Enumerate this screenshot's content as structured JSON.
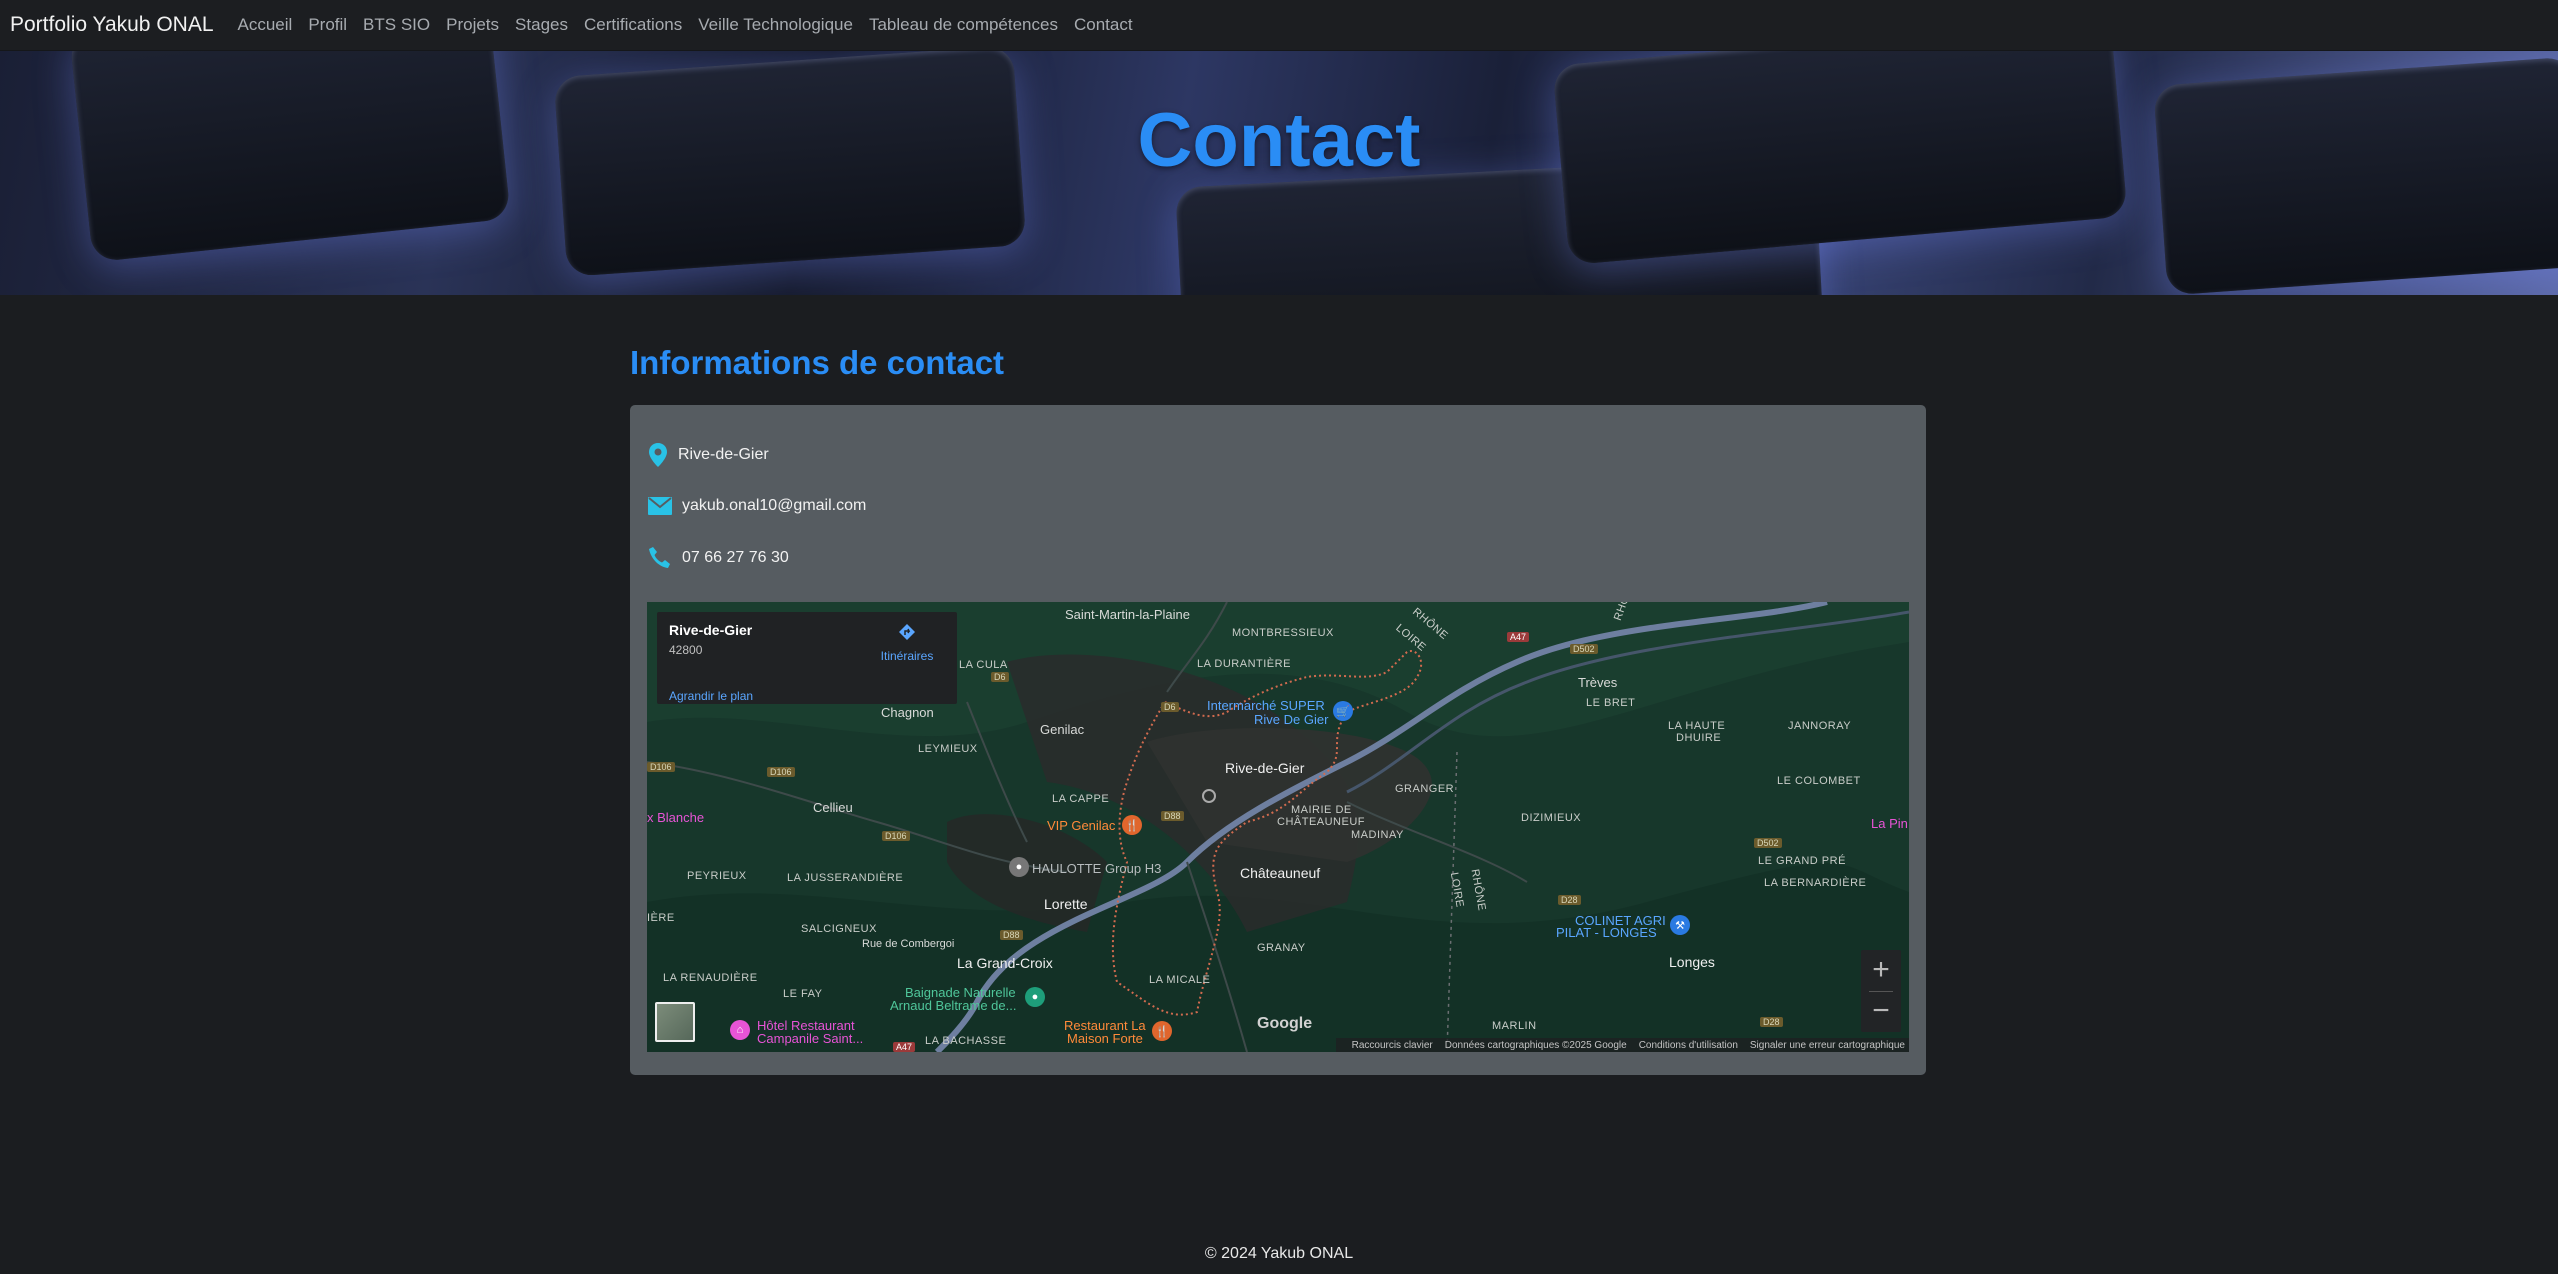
{
  "navbar": {
    "brand": "Portfolio Yakub ONAL",
    "links": [
      "Accueil",
      "Profil",
      "BTS SIO",
      "Projets",
      "Stages",
      "Certifications",
      "Veille Technologique",
      "Tableau de compétences",
      "Contact"
    ]
  },
  "hero": {
    "title": "Contact"
  },
  "contact": {
    "heading": "Informations de contact",
    "location": "Rive-de-Gier",
    "email": "yakub.onal10@gmail.com",
    "phone": "07 66 27 76 30"
  },
  "map": {
    "info": {
      "title": "Rive-de-Gier",
      "postcode": "42800",
      "directions": "Itinéraires",
      "enlarge": "Agrandir le plan"
    },
    "labels": {
      "saint_martin": "Saint-Martin-la-Plaine",
      "montbressieux": "MONTBRESSIEUX",
      "durantiere": "LA DURANTIÈRE",
      "la_cula": "LA CULA",
      "chagnon": "Chagnon",
      "genilac": "Genilac",
      "leymieux": "LEYMIEUX",
      "intermarche_1": "Intermarché SUPER",
      "intermarche_2": "Rive De Gier",
      "rive": "Rive-de-Gier",
      "treves": "Trèves",
      "le_bret": "LE BRET",
      "haute_dhuire_1": "LA HAUTE",
      "haute_dhuire_2": "DHUIRE",
      "janniorai": "JANNORAY",
      "colombet": "LE COLOMBET",
      "cellieu": "Cellieu",
      "la_cappe": "LA CAPPE",
      "croix_blanche": "x Blanche",
      "vip_genilac": "VIP Genilac",
      "granger": "GRANGER",
      "mairie_1": "MAIRIE DE",
      "mairie_2": "CHÂTEAUNEUF",
      "madinay": "MADINAY",
      "dizimieux": "DIZIMIEUX",
      "la_pin": "La Pin",
      "peyrieux": "PEYRIEUX",
      "jusseranderie": "LA JUSSERANDIÈRE",
      "haulotte": "HAULOTTE Group H3",
      "chateauneuf": "Châteauneuf",
      "grand_pre": "LE GRAND PRÉ",
      "bernardiere": "LA BERNARDIÈRE",
      "lorette": "Lorette",
      "saint_riere": "IÈRE",
      "salcigneux": "SALCIGNEUX",
      "rue_combe": "Rue de Combergoi",
      "granay": "GRANAY",
      "colinet_1": "COLINET AGRI",
      "colinet_2": "PILAT - LONGES",
      "grand_croix": "La Grand-Croix",
      "longes": "Longes",
      "renaudiere": "LA RENAUDIÈRE",
      "le_fay": "LE FAY",
      "baignade_1": "Baignade Naturelle",
      "baignade_2": "Arnaud Beltrame de...",
      "la_micale": "LA MICALE",
      "marlin": "MARLIN",
      "hotel_1": "Hôtel Restaurant",
      "hotel_2": "Campanile Saint...",
      "bachasse": "LA BACHASSE",
      "maison_1": "Restaurant La",
      "maison_2": "Maison Forte",
      "rhone_loire_1": "RHÔNE",
      "rhone_loire_2": "LOIRE",
      "rhone_loire_3": "RHÔNE",
      "rhone_loire_4": "LOIRE",
      "rhone_top": "RHÔ"
    },
    "road_tags": {
      "a47_top": "A47",
      "d502_top": "D502",
      "d6_a": "D6",
      "d6_b": "D6",
      "d106_a": "D106",
      "d106_b": "D106",
      "d106_c": "D106",
      "d88_a": "D88",
      "d88_b": "D88",
      "d502": "D502",
      "d28": "D28",
      "d28_b": "D28",
      "a47_bottom": "A47"
    },
    "zoom_in": "+",
    "zoom_out": "−",
    "google": "Google",
    "footer": {
      "shortcuts": "Raccourcis clavier",
      "data": "Données cartographiques ©2025 Google",
      "terms": "Conditions d'utilisation",
      "report": "Signaler une erreur cartographique"
    }
  },
  "footer": {
    "copyright": "© 2024 Yakub ONAL"
  }
}
